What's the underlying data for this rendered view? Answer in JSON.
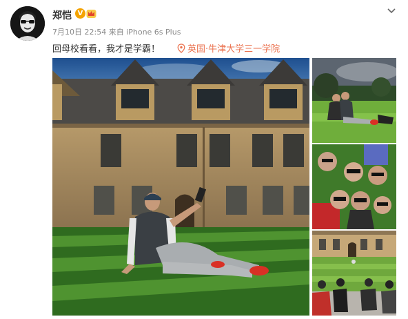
{
  "post": {
    "author": "郑恺",
    "verified_badge": "V",
    "meta": "7月10日 22:54 来自 iPhone 6s Plus",
    "text": "回母校看看，我才是学霸！",
    "location": "英国·牛津大学三一学院"
  },
  "icons": {
    "verified": "verified-v-icon",
    "member": "vip-crown-icon",
    "location": "location-pin-icon",
    "expand": "chevron-down-icon"
  },
  "colors": {
    "verified": "#f4a300",
    "location": "#eb7350",
    "meta": "#888888"
  }
}
